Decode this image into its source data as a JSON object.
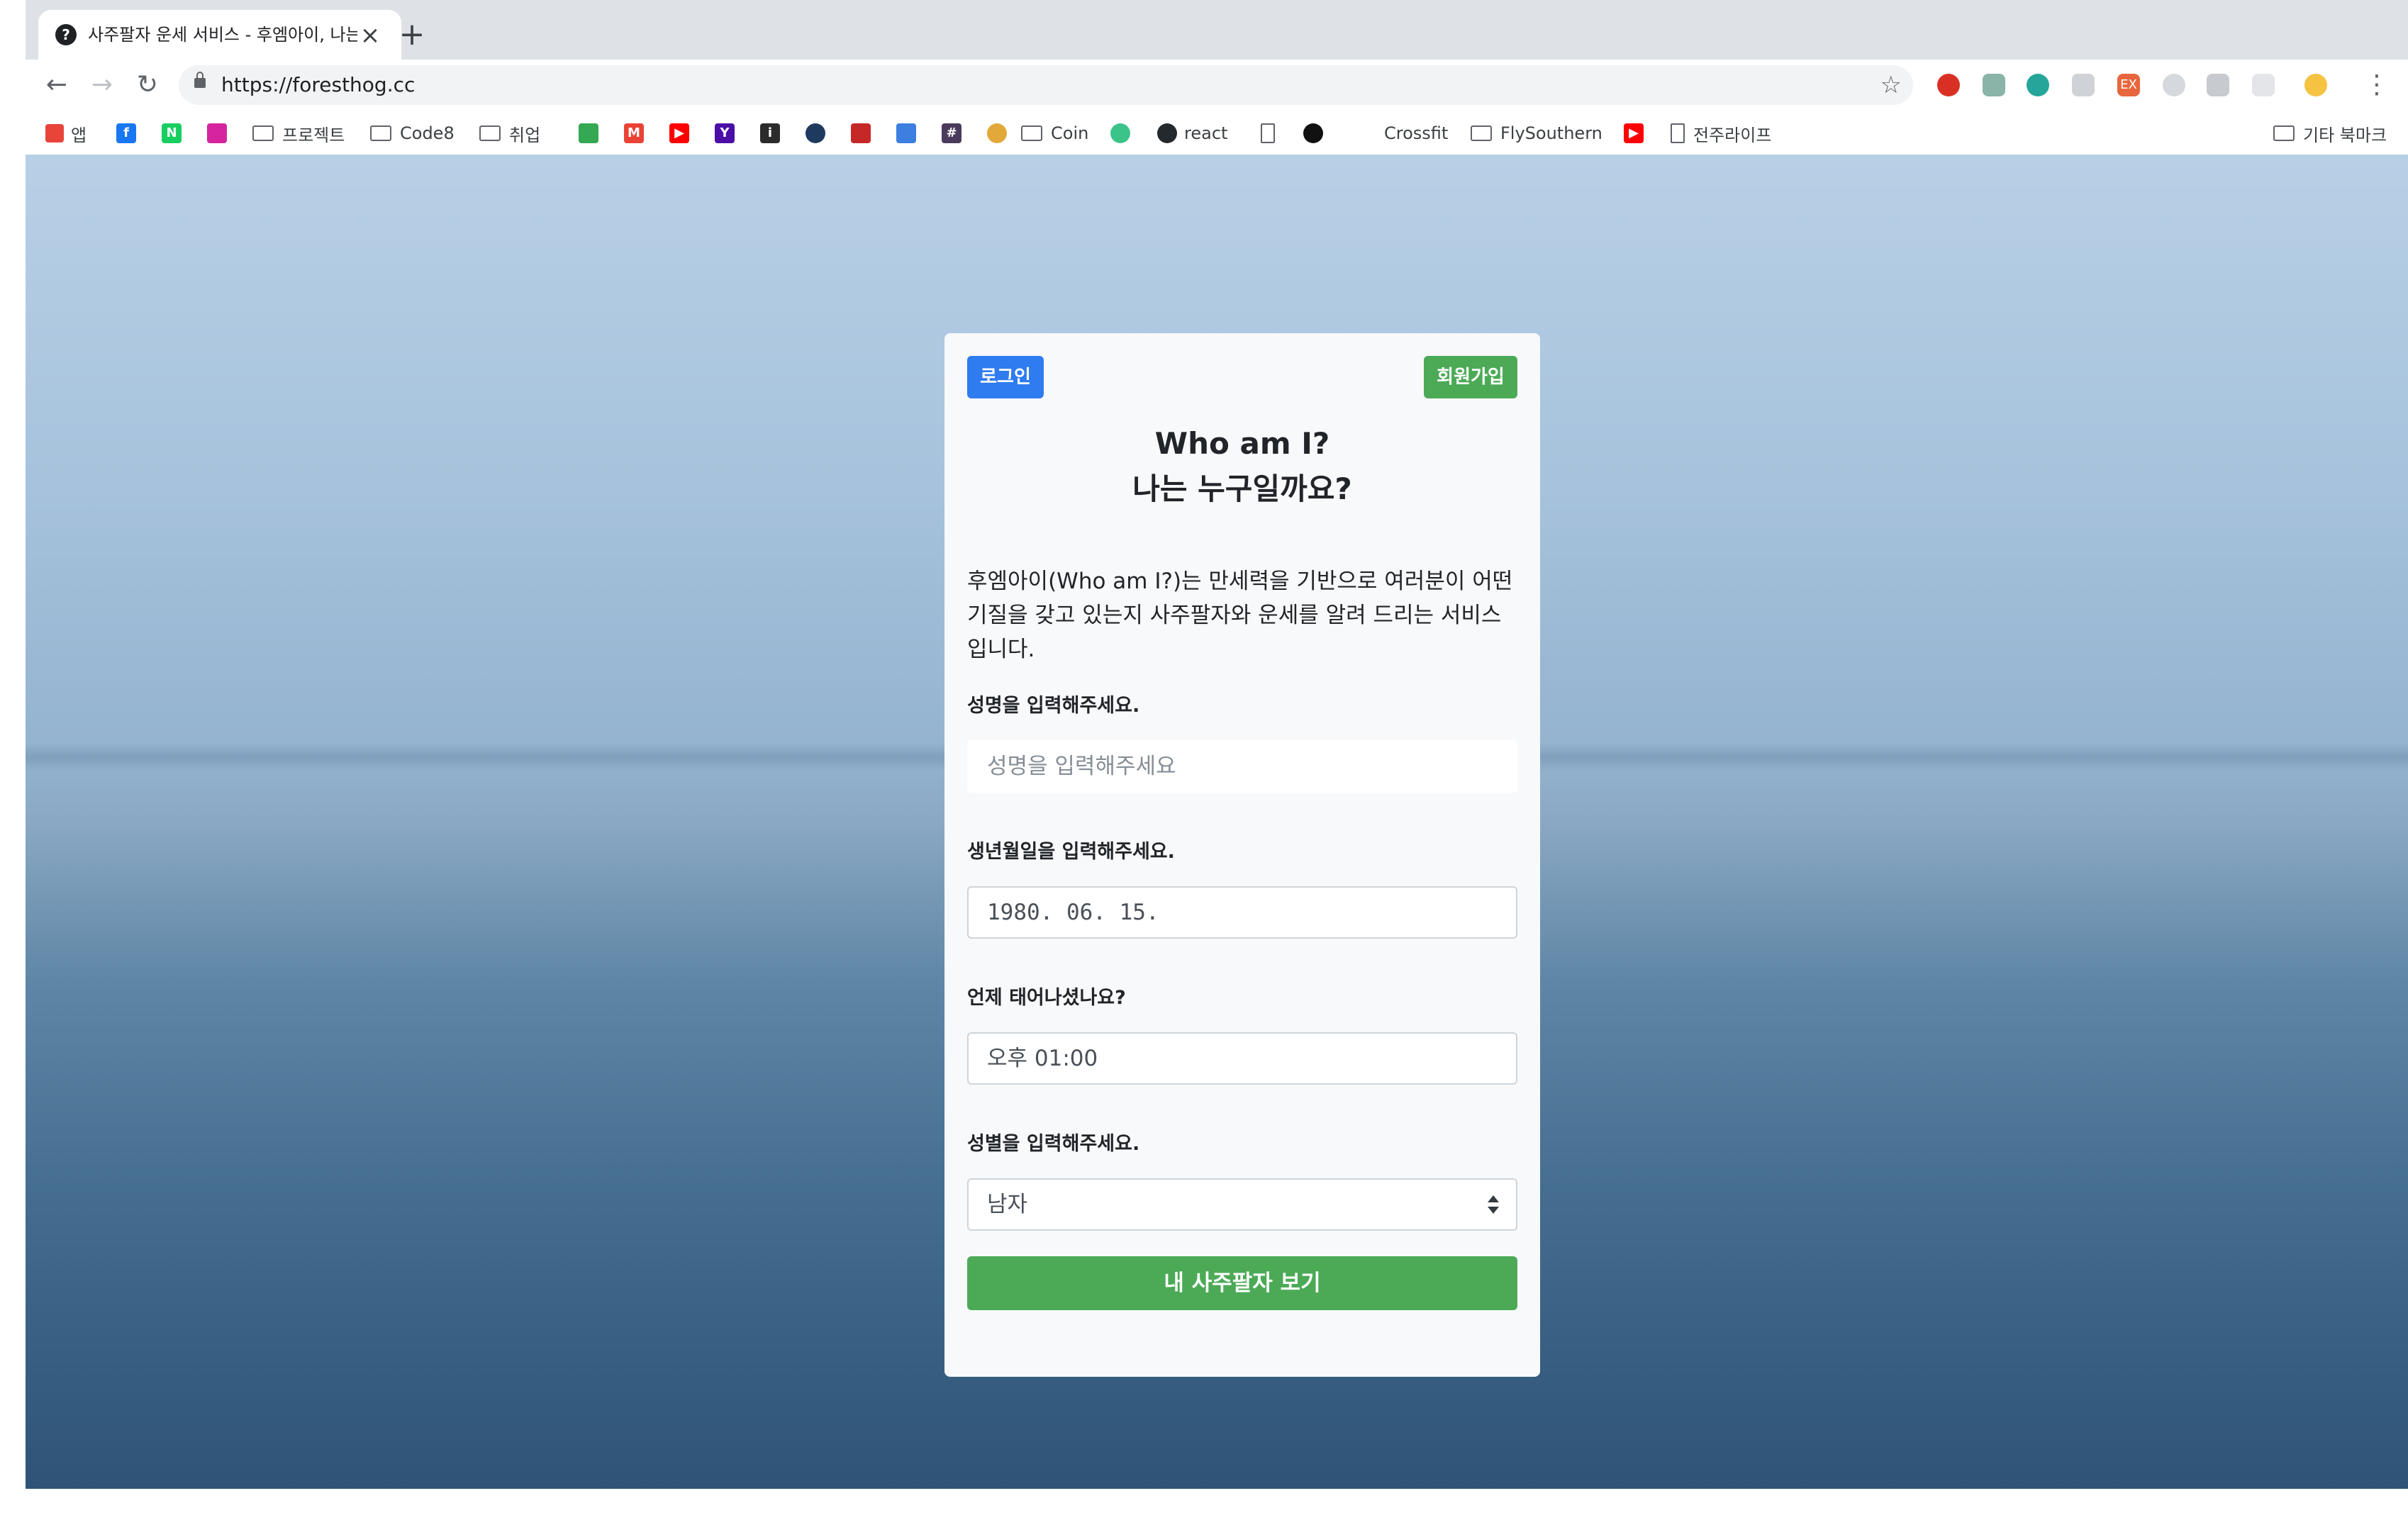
{
  "browser": {
    "tab_title": "사주팔자 운세 서비스 - 후엠아이, 나는",
    "tab_favicon": "?",
    "url": "https://foresthog.cc",
    "bookmarks": {
      "apps": "앱",
      "project": "프로젝트",
      "code8": "Code8",
      "job": "취업",
      "coin": "Coin",
      "react": "react",
      "crossfit": "Crossfit",
      "flysouthern": "FlySouthern",
      "jeonju": "전주라이프",
      "other": "기타 북마크"
    }
  },
  "auth": {
    "login": "로그인",
    "signup": "회원가입"
  },
  "main": {
    "title_en": "Who am I?",
    "title_ko": "나는 누구일까요?",
    "description": "후엠아이(Who am I?)는 만세력을 기반으로 여러분이 어떤 기질을 갖고 있는지 사주팔자와 운세를 알려 드리는 서비스입니다."
  },
  "form": {
    "name_label": "성명을 입력해주세요.",
    "name_placeholder": "성명을 입력해주세요",
    "birth_label": "생년월일을 입력해주세요.",
    "birth_value": "1980. 06. 15.",
    "time_label": "언제 태어나셨나요?",
    "time_value": "오후 01:00",
    "gender_label": "성별을 입력해주세요.",
    "gender_value": "남자",
    "submit": "내 사주팔자 보기"
  }
}
